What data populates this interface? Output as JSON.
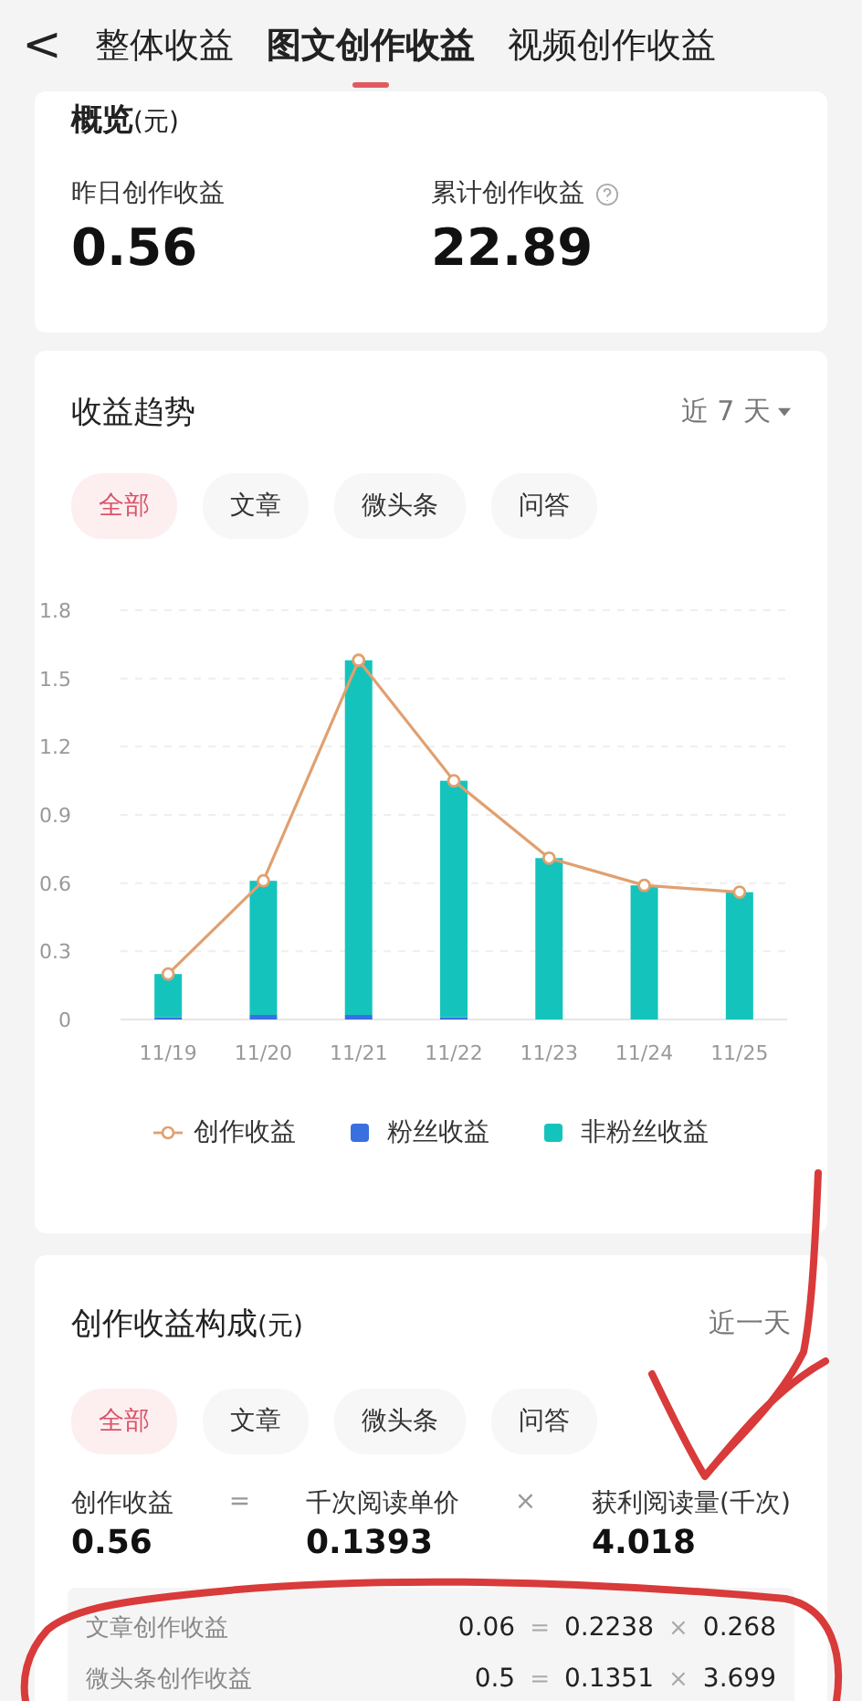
{
  "header": {
    "back": "<",
    "tabs": [
      {
        "label": "整体收益",
        "selected": false
      },
      {
        "label": "图文创作收益",
        "selected": true
      },
      {
        "label": "视频创作收益",
        "selected": false
      }
    ]
  },
  "overview": {
    "title": "概览",
    "unit": "(元)",
    "stats": [
      {
        "label": "昨日创作收益",
        "value": "0.56",
        "help": false
      },
      {
        "label": "累计创作收益",
        "value": "22.89",
        "help": true
      }
    ]
  },
  "trend": {
    "title": "收益趋势",
    "range": "近 7 天",
    "chips": [
      {
        "label": "全部",
        "selected": true
      },
      {
        "label": "文章",
        "selected": false
      },
      {
        "label": "微头条",
        "selected": false
      },
      {
        "label": "问答",
        "selected": false
      }
    ],
    "chart_data": {
      "type": "bar",
      "stacked": true,
      "grid": true,
      "categories": [
        "11/19",
        "11/20",
        "11/21",
        "11/22",
        "11/23",
        "11/24",
        "11/25"
      ],
      "ylim": [
        0,
        1.8
      ],
      "yticks": [
        0,
        0.3,
        0.6,
        0.9,
        1.2,
        1.5,
        1.8
      ],
      "series": [
        {
          "name": "创作收益",
          "type": "line",
          "marker": true,
          "color": "#e0a070",
          "values": [
            0.2,
            0.61,
            1.58,
            1.05,
            0.71,
            0.59,
            0.56
          ]
        },
        {
          "name": "粉丝收益",
          "type": "bar",
          "color": "#3a6fe0",
          "values": [
            0.01,
            0.02,
            0.02,
            0.01,
            0,
            0,
            0
          ]
        },
        {
          "name": "非粉丝收益",
          "type": "bar",
          "color": "#14c4bc",
          "values": [
            0.19,
            0.59,
            1.56,
            1.04,
            0.71,
            0.59,
            0.56
          ]
        }
      ]
    }
  },
  "composition": {
    "title": "创作收益构成",
    "unit": "(元)",
    "range": "近一天",
    "chips": [
      {
        "label": "全部",
        "selected": true
      },
      {
        "label": "文章",
        "selected": false
      },
      {
        "label": "微头条",
        "selected": false
      },
      {
        "label": "问答",
        "selected": false
      }
    ],
    "formula": [
      {
        "kind": "term",
        "label": "创作收益",
        "value": "0.56"
      },
      {
        "kind": "op",
        "label": "="
      },
      {
        "kind": "term",
        "label": "千次阅读单价",
        "value": "0.1393"
      },
      {
        "kind": "op",
        "label": "×"
      },
      {
        "kind": "term",
        "label": "获利阅读量(千次)",
        "value": "4.018"
      }
    ],
    "rows": [
      {
        "label": "文章创作收益",
        "parts": [
          "0.06",
          "=",
          "0.2238",
          "×",
          "0.268"
        ]
      },
      {
        "label": "微头条创作收益",
        "parts": [
          "0.5",
          "=",
          "0.1351",
          "×",
          "3.699"
        ]
      }
    ]
  },
  "markup": {
    "arrow": true,
    "ellipse": true
  }
}
